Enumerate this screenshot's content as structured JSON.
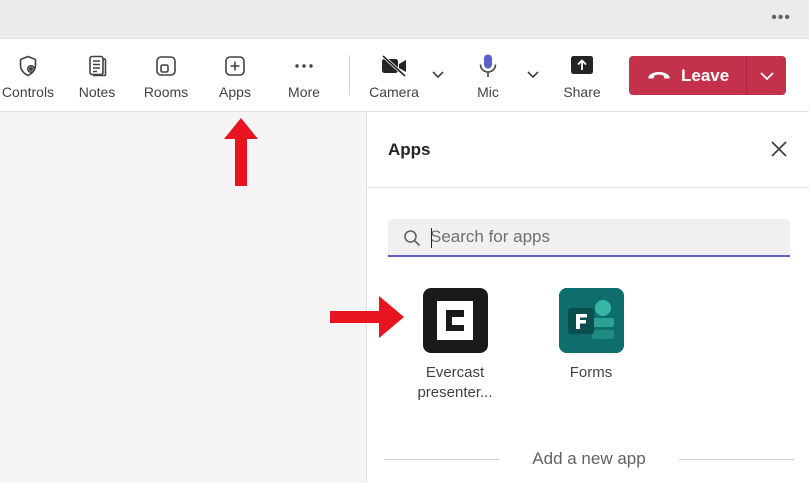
{
  "toolbar": {
    "items": [
      {
        "label": "Controls",
        "icon": "shield-gear-icon"
      },
      {
        "label": "Notes",
        "icon": "notes-icon"
      },
      {
        "label": "Rooms",
        "icon": "rooms-icon"
      },
      {
        "label": "Apps",
        "icon": "plus-box-icon"
      },
      {
        "label": "More",
        "icon": "ellipsis-icon"
      },
      {
        "label": "Camera",
        "icon": "camera-off-icon"
      },
      {
        "label": "Mic",
        "icon": "microphone-icon"
      },
      {
        "label": "Share",
        "icon": "share-icon"
      }
    ],
    "leave_label": "Leave",
    "leave_color": "#c4314b"
  },
  "apps_panel": {
    "title": "Apps",
    "search_placeholder": "Search for apps",
    "search_underline_color": "#5b5fc7",
    "apps": [
      {
        "name_line1": "Evercast",
        "name_line2": "presenter...",
        "icon": "evercast-logo"
      },
      {
        "name_line1": "Forms",
        "name_line2": "",
        "icon": "forms-logo"
      }
    ],
    "add_new_app": "Add a new app"
  },
  "annotations": {
    "arrow_color": "#e8141f"
  }
}
